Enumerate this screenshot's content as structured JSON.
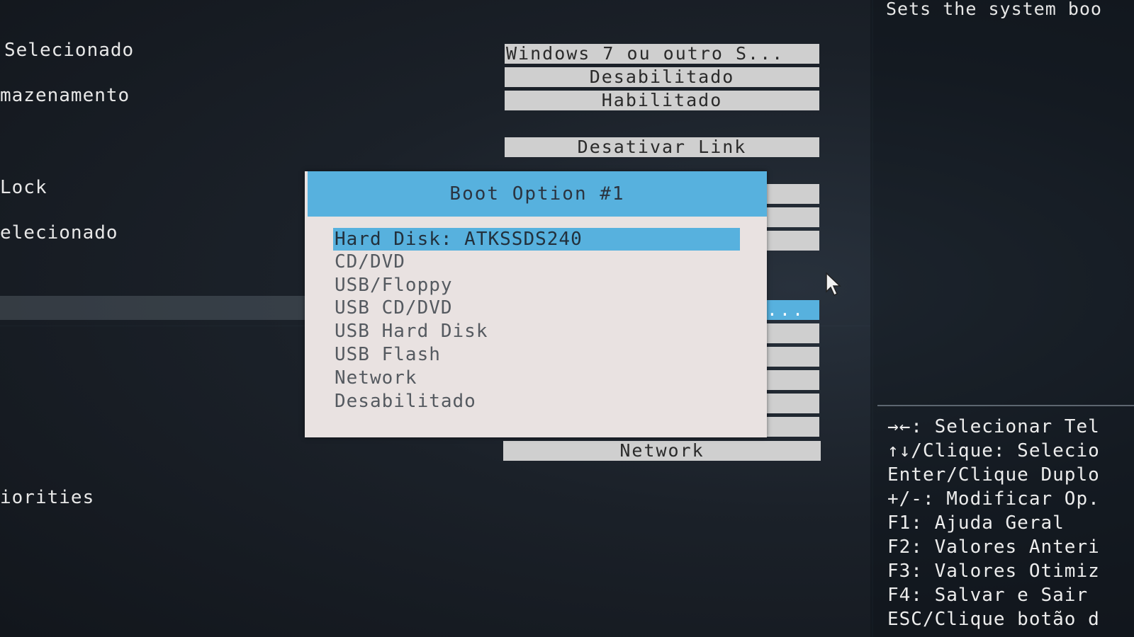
{
  "left_menu": {
    "items": [
      {
        "label": "Selecionado"
      },
      {
        "label": "mazenamento"
      },
      {
        "label": "Lock"
      },
      {
        "label": "elecionado"
      },
      {
        "label": "iorities"
      }
    ]
  },
  "settings": {
    "values": [
      "Windows 7 ou outro S...",
      "Desabilitado",
      "Habilitado",
      "Desativar Link"
    ],
    "selected_value": "...",
    "last_value": "Network"
  },
  "help": {
    "description": "Sets the system boo",
    "keys": [
      "→←: Selecionar Tel",
      "↑↓/Clique: Selecio",
      "Enter/Clique Duplo",
      "+/-: Modificar Op.",
      "F1: Ajuda Geral",
      "F2: Valores Anteri",
      "F3: Valores Otimiz",
      "F4: Salvar e Sair",
      "ESC/Clique botão d"
    ]
  },
  "popup": {
    "title": "Boot Option #1",
    "options": [
      "Hard Disk: ATKSSDS240",
      "CD/DVD",
      "USB/Floppy",
      "USB CD/DVD",
      "USB Hard Disk",
      "USB Flash",
      "Network",
      "Desabilitado"
    ],
    "selected_index": 0
  },
  "colors": {
    "accent": "#57b1de",
    "popup_bg": "#e9e2e1",
    "value_box_bg": "#cfcfcf",
    "screen_bg": "#1b2129"
  }
}
